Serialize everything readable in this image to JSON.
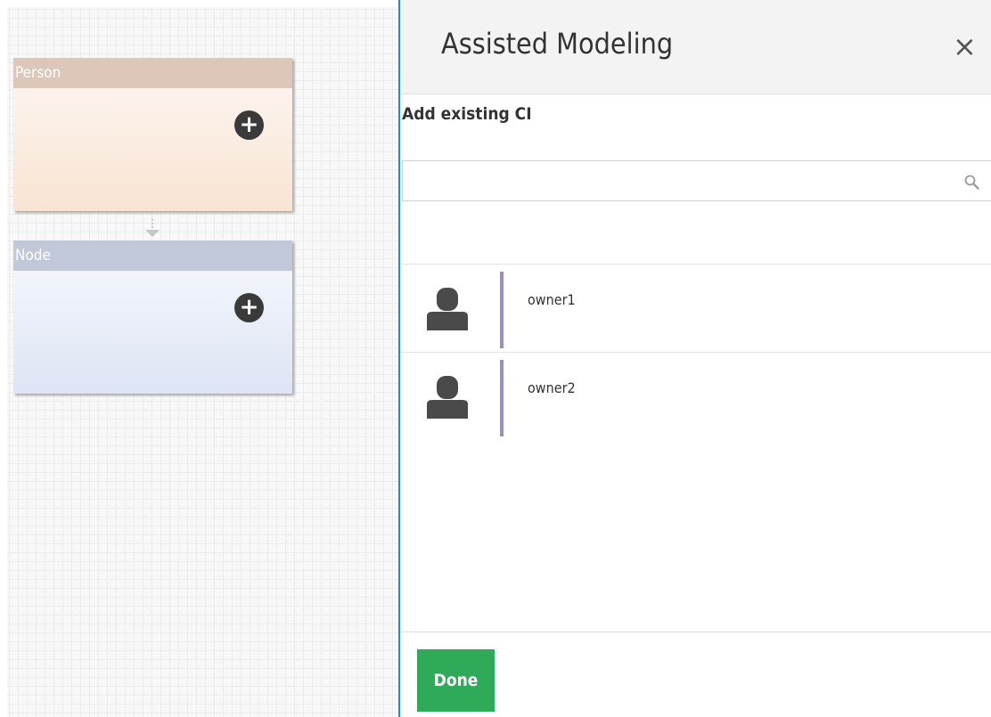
{
  "canvas": {
    "ci_boxes": [
      {
        "label": "Person"
      },
      {
        "label": "Node"
      }
    ],
    "add_button_glyph": "+"
  },
  "panel": {
    "title": "Assisted Modeling",
    "close_glyph": "×",
    "section_title": "Add existing CI",
    "search": {
      "value": "",
      "placeholder": ""
    },
    "items": [
      {
        "label": "owner1",
        "icon": "person-icon"
      },
      {
        "label": "owner2",
        "icon": "person-icon"
      }
    ],
    "done_label": "Done"
  },
  "colors": {
    "accent_border": "#1b8ecf",
    "done_button": "#2eaa58",
    "item_bar": "#9c8dc5",
    "person_header": "#dcc7b9",
    "node_header": "#c1c8d9"
  }
}
